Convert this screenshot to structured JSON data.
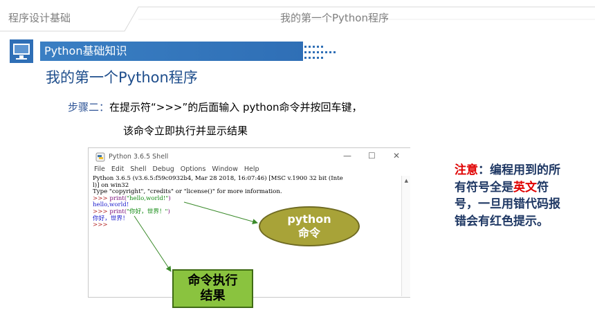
{
  "header": {
    "left_title": "程序设计基础",
    "right_title": "我的第一个Python程序"
  },
  "section": {
    "bar_label": "Python基础知识"
  },
  "page_title": "我的第一个Python程序",
  "steps": {
    "step_label": "步骤二：",
    "step_text1": "在提示符“>>>”的后面输入 python命令并按回车键，",
    "step_text2": "该命令立即执行并显示结果"
  },
  "shell": {
    "window_title": "Python 3.6.5 Shell",
    "controls": [
      "—",
      "☐",
      "✕"
    ],
    "menu": [
      "File",
      "Edit",
      "Shell",
      "Debug",
      "Options",
      "Window",
      "Help"
    ],
    "lines": {
      "banner1": "Python 3.6.5 (v3.6.5:f59c0932b4, Mar 28 2018, 16:07:46) [MSC v.1900 32 bit (Inte",
      "banner2": "l)] on win32",
      "banner3": "Type \"copyright\", \"credits\" or \"license()\" for more information.",
      "prompt": ">>> ",
      "cmd1_func": "print(",
      "cmd1_str": "\"hello,world!\"",
      "cmd1_close": ")",
      "out1": "hello,world!",
      "cmd2_func": "print(",
      "cmd2_str": "\"你好，世界！\"",
      "cmd2_close": ")",
      "out2": "你好，世界！",
      "prompt_last": ">>>"
    }
  },
  "callouts": {
    "oval_line1": "python",
    "oval_line2": "命令",
    "box_line1": "命令执行",
    "box_line2": "结果"
  },
  "note": {
    "part1_red": "注意",
    "part2": "：编程用到的所有符号全是",
    "part3_red": "英文",
    "part4": "符号，一旦用错代码报错会有红色提示。"
  },
  "colors": {
    "accent_blue": "#2f6fb6",
    "oval_fill": "#a8a338",
    "box_fill": "#8ac33f",
    "warning_red": "#e00000"
  }
}
